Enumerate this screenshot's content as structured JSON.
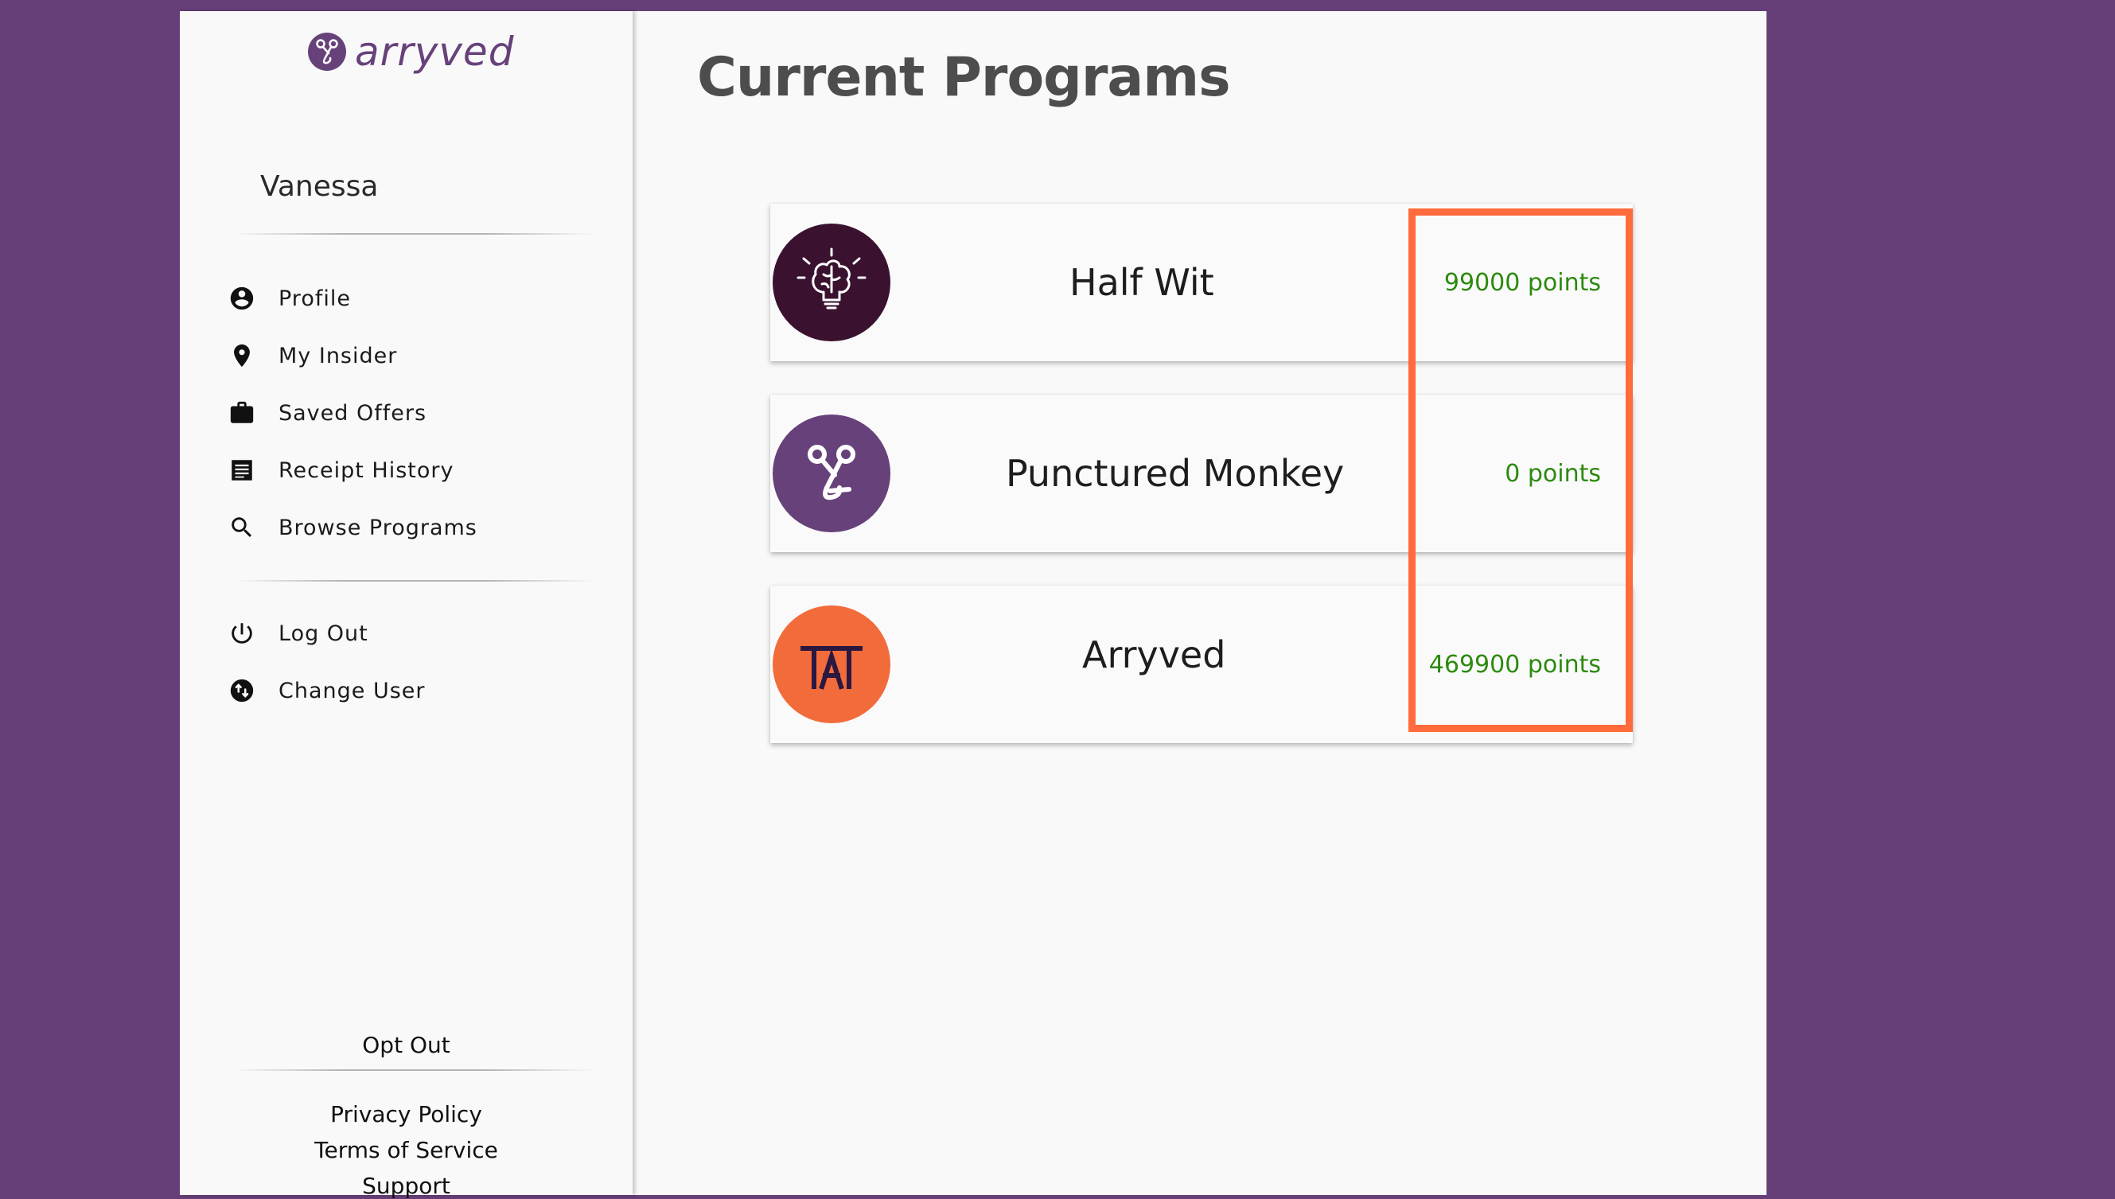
{
  "brand": {
    "name": "arryved",
    "color": "#67417a"
  },
  "user": {
    "name": "Vanessa"
  },
  "nav": {
    "items": [
      {
        "label": "Profile",
        "icon": "account-circle-icon"
      },
      {
        "label": "My Insider",
        "icon": "location-pin-icon",
        "highlighted": true
      },
      {
        "label": "Saved Offers",
        "icon": "briefcase-icon"
      },
      {
        "label": "Receipt History",
        "icon": "receipt-icon"
      },
      {
        "label": "Browse Programs",
        "icon": "search-icon"
      }
    ],
    "secondary": [
      {
        "label": "Log Out",
        "icon": "power-icon"
      },
      {
        "label": "Change User",
        "icon": "switch-user-icon"
      }
    ]
  },
  "footer": {
    "opt_out": "Opt Out",
    "privacy": "Privacy Policy",
    "terms": "Terms of Service",
    "support": "Support"
  },
  "main": {
    "title": "Current Programs",
    "programs": [
      {
        "name": "Half Wit",
        "points": "99000 points",
        "icon": "brain-bulb-icon",
        "color": "#3a1230"
      },
      {
        "name": "Punctured Monkey",
        "points": "0 points",
        "icon": "arryved-knot-icon",
        "color": "#67417a"
      },
      {
        "name": "Arryved",
        "points": "469900 points",
        "icon": "tap-logo-icon",
        "color": "#f26b3a"
      }
    ]
  },
  "colors": {
    "background": "#673f78",
    "highlight": "#ff6b3d",
    "points": "#2c8a0e"
  }
}
